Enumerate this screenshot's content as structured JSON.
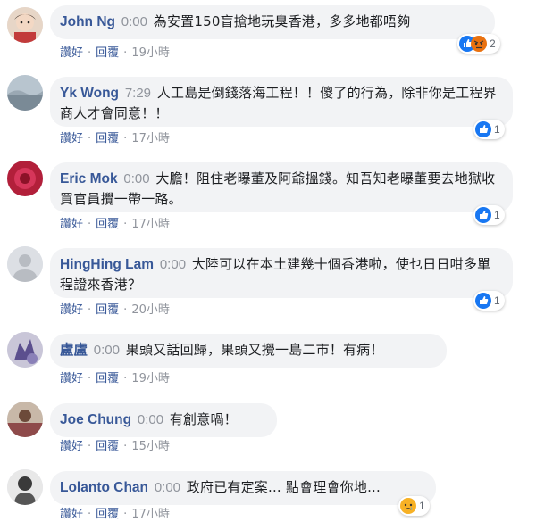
{
  "comments": [
    {
      "author": "John Ng",
      "time": "0:00",
      "text": "為安置150盲搶地玩臭香港，多多地都唔夠",
      "like": "讚好",
      "reply": "回覆",
      "ago": "19小時",
      "reaction": {
        "icons": [
          "like-icon",
          "angry-icon"
        ],
        "count": "2"
      }
    },
    {
      "author": "Yk Wong",
      "time": "7:29",
      "text": "人工島是倒錢落海工程！！傻了的行為，除非你是工程界商人才會同意！！",
      "like": "讚好",
      "reply": "回覆",
      "ago": "17小時",
      "reaction": {
        "icons": [
          "like-icon"
        ],
        "count": "1"
      }
    },
    {
      "author": "Eric Mok",
      "time": "0:00",
      "text": "大膽！阻住老曝董及阿爺搵錢。知吾知老曝董要去地獄收買官員攪一帶一路。",
      "like": "讚好",
      "reply": "回覆",
      "ago": "17小時",
      "reaction": {
        "icons": [
          "like-icon"
        ],
        "count": "1"
      }
    },
    {
      "author": "HingHing Lam",
      "time": "0:00",
      "text": "大陸可以在本土建幾十個香港啦，使乜日日咁多單程證來香港？",
      "like": "讚好",
      "reply": "回覆",
      "ago": "20小時",
      "reaction": {
        "icons": [
          "like-icon"
        ],
        "count": "1"
      }
    },
    {
      "author": "盧盧",
      "time": "0:00",
      "text": "果頭又話回歸，果頭又攪一島二市！有病！",
      "like": "讚好",
      "reply": "回覆",
      "ago": "19小時",
      "reaction": null
    },
    {
      "author": "Joe Chung",
      "time": "0:00",
      "text": "有創意喎！",
      "like": "讚好",
      "reply": "回覆",
      "ago": "15小時",
      "reaction": null
    },
    {
      "author": "Lolanto Chan",
      "time": "0:00",
      "text": "政府已有定案... 點會理會你地...",
      "like": "讚好",
      "reply": "回覆",
      "ago": "17小時",
      "reaction": {
        "icons": [
          "sad-icon"
        ],
        "count": "1"
      }
    }
  ],
  "colors": {
    "author": "#385898",
    "bubble": "#f2f3f5",
    "like_blue": "#1877f2",
    "angry": "#e9710f",
    "sad": "#f7b125"
  }
}
